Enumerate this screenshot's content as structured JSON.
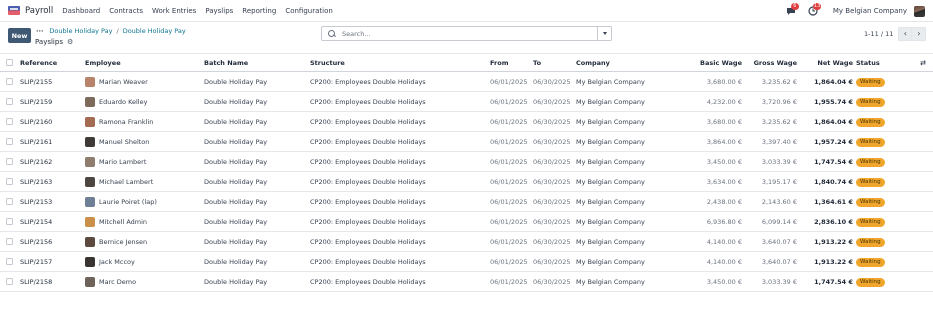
{
  "app": {
    "name": "Payroll"
  },
  "menu": [
    "Dashboard",
    "Contracts",
    "Work Entries",
    "Payslips",
    "Reporting",
    "Configuration"
  ],
  "systray": {
    "messages_count": "6",
    "activities_count": "13",
    "company": "My Belgian Company"
  },
  "control_panel": {
    "new_label": "New",
    "breadcrumbs": [
      "Double Holiday Pay",
      "Double Holiday Pay"
    ],
    "current": "Payslips",
    "search_placeholder": "Search...",
    "pager": "1-11 / 11"
  },
  "table": {
    "columns": [
      "Reference",
      "Employee",
      "Batch Name",
      "Structure",
      "From",
      "To",
      "Company",
      "Basic Wage",
      "Gross Wage",
      "Net Wage",
      "Status"
    ],
    "rows": [
      {
        "ref": "SLIP/2155",
        "employee": "Marian Weaver",
        "batch": "Double Holiday Pay",
        "structure": "CP200: Employees Double Holidays",
        "from": "06/01/2025",
        "to": "06/30/2025",
        "company": "My Belgian Company",
        "basic": "3,680.00 €",
        "gross": "3,235.62 €",
        "net": "1,864.04 €",
        "status": "Waiting",
        "avatar": "#b9826a"
      },
      {
        "ref": "SLIP/2159",
        "employee": "Eduardo Kelley",
        "batch": "Double Holiday Pay",
        "structure": "CP200: Employees Double Holidays",
        "from": "06/01/2025",
        "to": "06/30/2025",
        "company": "My Belgian Company",
        "basic": "4,232.00 €",
        "gross": "3,720.96 €",
        "net": "1,955.74 €",
        "status": "Waiting",
        "avatar": "#7c6a5a"
      },
      {
        "ref": "SLIP/2160",
        "employee": "Ramona Franklin",
        "batch": "Double Holiday Pay",
        "structure": "CP200: Employees Double Holidays",
        "from": "06/01/2025",
        "to": "06/30/2025",
        "company": "My Belgian Company",
        "basic": "3,680.00 €",
        "gross": "3,235.62 €",
        "net": "1,864.04 €",
        "status": "Waiting",
        "avatar": "#a56b52"
      },
      {
        "ref": "SLIP/2161",
        "employee": "Manuel Shelton",
        "batch": "Double Holiday Pay",
        "structure": "CP200: Employees Double Holidays",
        "from": "06/01/2025",
        "to": "06/30/2025",
        "company": "My Belgian Company",
        "basic": "3,864.00 €",
        "gross": "3,397.40 €",
        "net": "1,957.24 €",
        "status": "Waiting",
        "avatar": "#3f3a36"
      },
      {
        "ref": "SLIP/2162",
        "employee": "Mario Lambert",
        "batch": "Double Holiday Pay",
        "structure": "CP200: Employees Double Holidays",
        "from": "06/01/2025",
        "to": "06/30/2025",
        "company": "My Belgian Company",
        "basic": "3,450.00 €",
        "gross": "3,033.39 €",
        "net": "1,747.54 €",
        "status": "Waiting",
        "avatar": "#8e7d6e"
      },
      {
        "ref": "SLIP/2163",
        "employee": "Michael Lambert",
        "batch": "Double Holiday Pay",
        "structure": "CP200: Employees Double Holidays",
        "from": "06/01/2025",
        "to": "06/30/2025",
        "company": "My Belgian Company",
        "basic": "3,634.00 €",
        "gross": "3,195.17 €",
        "net": "1,840.74 €",
        "status": "Waiting",
        "avatar": "#4d4540"
      },
      {
        "ref": "SLIP/2153",
        "employee": "Laurie Poiret (lap)",
        "batch": "Double Holiday Pay",
        "structure": "CP200: Employees Double Holidays",
        "from": "06/01/2025",
        "to": "06/30/2025",
        "company": "My Belgian Company",
        "basic": "2,438.00 €",
        "gross": "2,143.60 €",
        "net": "1,364.61 €",
        "status": "Waiting",
        "avatar": "#6f7f95"
      },
      {
        "ref": "SLIP/2154",
        "employee": "Mitchell Admin",
        "batch": "Double Holiday Pay",
        "structure": "CP200: Employees Double Holidays",
        "from": "06/01/2025",
        "to": "06/30/2025",
        "company": "My Belgian Company",
        "basic": "6,936.80 €",
        "gross": "6,099.14 €",
        "net": "2,836.10 €",
        "status": "Waiting",
        "avatar": "#c9904a"
      },
      {
        "ref": "SLIP/2156",
        "employee": "Bernice Jensen",
        "batch": "Double Holiday Pay",
        "structure": "CP200: Employees Double Holidays",
        "from": "06/01/2025",
        "to": "06/30/2025",
        "company": "My Belgian Company",
        "basic": "4,140.00 €",
        "gross": "3,640.07 €",
        "net": "1,913.22 €",
        "status": "Waiting",
        "avatar": "#5c4a3e"
      },
      {
        "ref": "SLIP/2157",
        "employee": "Jack Mccoy",
        "batch": "Double Holiday Pay",
        "structure": "CP200: Employees Double Holidays",
        "from": "06/01/2025",
        "to": "06/30/2025",
        "company": "My Belgian Company",
        "basic": "4,140.00 €",
        "gross": "3,640.07 €",
        "net": "1,913.22 €",
        "status": "Waiting",
        "avatar": "#39342f"
      },
      {
        "ref": "SLIP/2158",
        "employee": "Marc Demo",
        "batch": "Double Holiday Pay",
        "structure": "CP200: Employees Double Holidays",
        "from": "06/01/2025",
        "to": "06/30/2025",
        "company": "My Belgian Company",
        "basic": "3,450.00 €",
        "gross": "3,033.39 €",
        "net": "1,747.54 €",
        "status": "Waiting",
        "avatar": "#6e625a"
      }
    ]
  }
}
